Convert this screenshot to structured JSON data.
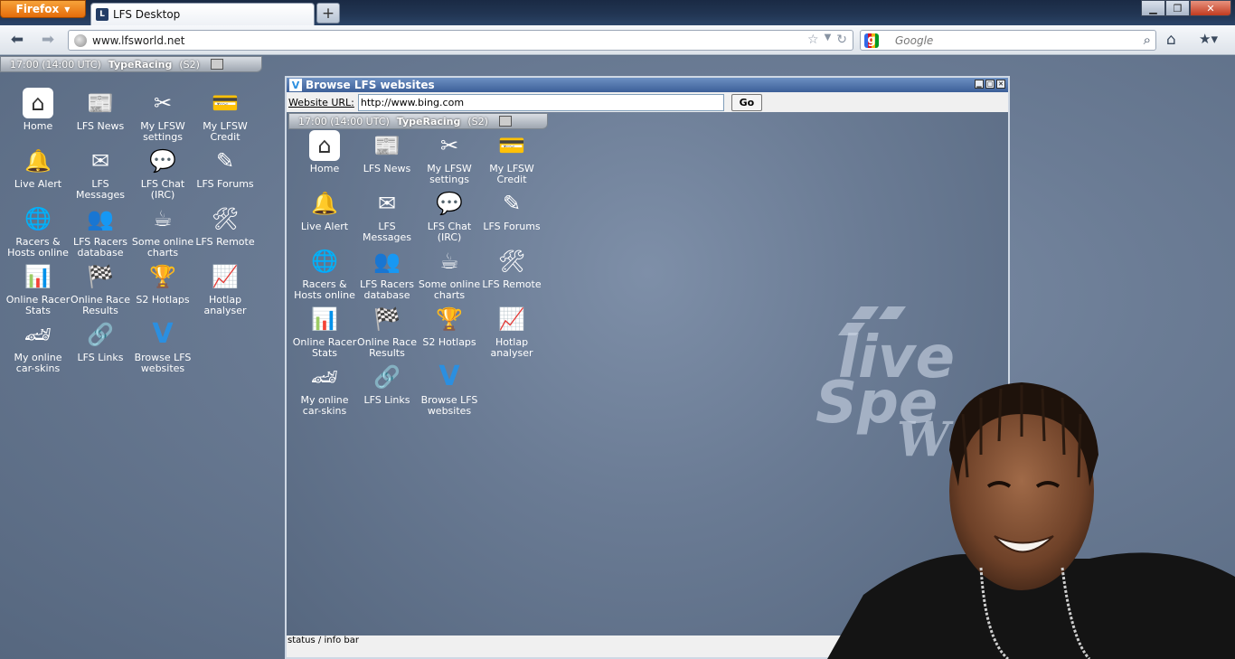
{
  "browser": {
    "app_button": "Firefox",
    "tab_title": "LFS Desktop",
    "favicon": "LFS",
    "url": "www.lfsworld.net",
    "search_placeholder": "Google",
    "new_tab": "+"
  },
  "lfs": {
    "clock": "17:00 (14:00 UTC)",
    "user": "TypeRacing",
    "license": "(S2)",
    "icons": [
      {
        "label": "Home",
        "icon": "home-icon"
      },
      {
        "label": "LFS News",
        "icon": "news-icon"
      },
      {
        "label": "My LFSW settings",
        "icon": "settings-icon"
      },
      {
        "label": "My LFSW Credit",
        "icon": "credit-icon"
      },
      {
        "label": "Live Alert",
        "icon": "alert-icon"
      },
      {
        "label": "LFS Messages",
        "icon": "messages-icon"
      },
      {
        "label": "LFS Chat (IRC)",
        "icon": "chat-icon"
      },
      {
        "label": "LFS Forums",
        "icon": "forums-icon"
      },
      {
        "label": "Racers & Hosts online",
        "icon": "globe-icon"
      },
      {
        "label": "LFS Racers database",
        "icon": "racers-icon"
      },
      {
        "label": "Some online charts",
        "icon": "coffee-icon"
      },
      {
        "label": "LFS Remote",
        "icon": "remote-icon"
      },
      {
        "label": "Online Racer Stats",
        "icon": "stats-icon"
      },
      {
        "label": "Online Race Results",
        "icon": "results-icon"
      },
      {
        "label": "S2 Hotlaps",
        "icon": "trophy-icon"
      },
      {
        "label": "Hotlap analyser",
        "icon": "analyser-icon"
      },
      {
        "label": "My online car-skins",
        "icon": "car-icon"
      },
      {
        "label": "LFS Links",
        "icon": "links-icon"
      },
      {
        "label": "Browse LFS websites",
        "icon": "browse-icon"
      }
    ]
  },
  "browse_window": {
    "title": "Browse LFS websites",
    "url_label": "Website URL:",
    "url_value": "http://www.bing.com",
    "go_label": "Go",
    "status": "status / info bar"
  }
}
